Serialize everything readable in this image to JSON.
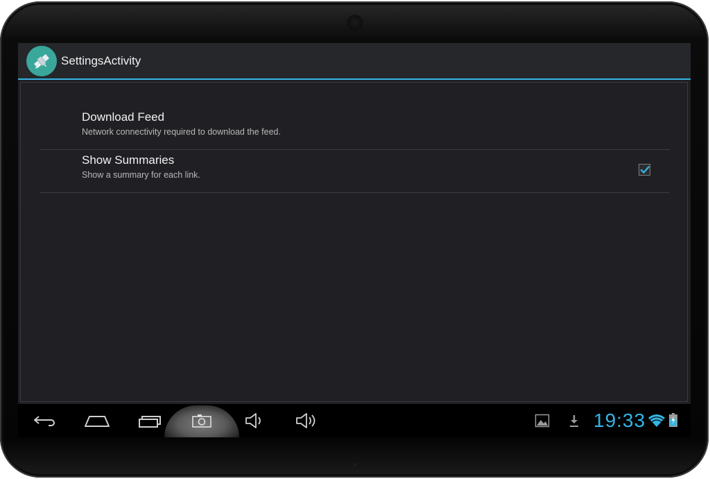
{
  "app": {
    "title": "SettingsActivity",
    "icon": "satellite-icon",
    "accent_color": "#33b5e5"
  },
  "preferences": [
    {
      "title": "Download Feed",
      "summary": "Network connectivity required to download the feed.",
      "has_checkbox": false
    },
    {
      "title": "Show Summaries",
      "summary": "Show a summary for each link.",
      "has_checkbox": true,
      "checked": true
    }
  ],
  "navbar": {
    "buttons": [
      "back-icon",
      "home-icon",
      "recent-apps-icon",
      "screenshot-icon",
      "volume-down-icon",
      "volume-up-icon"
    ]
  },
  "status": {
    "time": "19:33",
    "icons": [
      "gallery-notification-icon",
      "download-notification-icon",
      "wifi-icon",
      "battery-charging-icon"
    ]
  }
}
